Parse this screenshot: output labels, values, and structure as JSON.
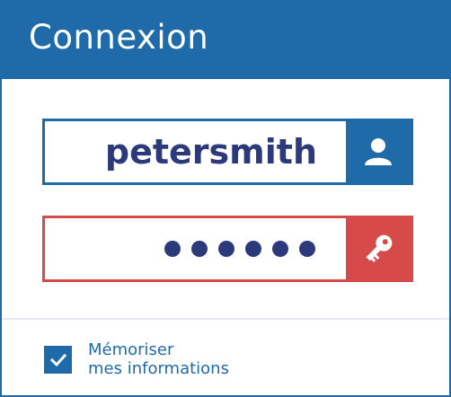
{
  "header": {
    "title": "Connexion"
  },
  "username": {
    "value": "petersmith",
    "icon": "user-icon"
  },
  "password": {
    "masked_length": 6,
    "icon": "key-icon"
  },
  "remember": {
    "checked": true,
    "label_line1": "Mémoriser",
    "label_line2": "mes informations"
  },
  "colors": {
    "primary": "#1f6aa8",
    "danger": "#d64a4a",
    "text": "#2c3a7b"
  }
}
